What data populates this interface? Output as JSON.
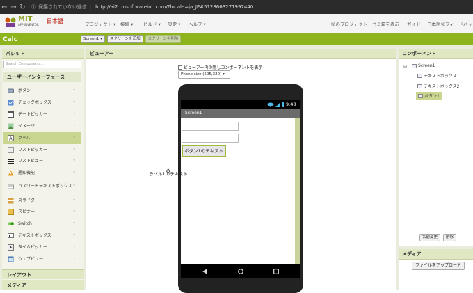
{
  "browser": {
    "security": "保護されていない通信",
    "url": "http://ai2.tmsoftwareinc.com/?locale=ja_JP#5128663271997440"
  },
  "header": {
    "logo_mit": "MIT",
    "logo_sub": "APP INVENTOR",
    "logo_lang": "日本語",
    "menus": [
      "プロジェクト ▾",
      "接続 ▾",
      "ビルド ▾",
      "設定 ▾",
      "ヘルプ ▾"
    ],
    "right_links": [
      "私のプロジェクト",
      "ゴミ箱を表示",
      "ガイド",
      "日本語化フィードバック"
    ]
  },
  "project": {
    "name": "Calc",
    "screen_select": "Screen1 ▾",
    "add_screen": "スクリーンを追加",
    "remove_screen": "スクリーンを削除"
  },
  "palette": {
    "title": "パレット",
    "search_placeholder": "Search Components...",
    "category": "ユーザーインターフェース",
    "items": [
      {
        "label": "ボタン",
        "icon": "button-icon"
      },
      {
        "label": "チェックボックス",
        "icon": "checkbox-icon"
      },
      {
        "label": "デートピッカー",
        "icon": "datepicker-icon"
      },
      {
        "label": "イメージ",
        "icon": "image-icon"
      },
      {
        "label": "ラベル",
        "icon": "label-icon",
        "selected": true
      },
      {
        "label": "リストピッカー",
        "icon": "listpicker-icon"
      },
      {
        "label": "リストビュー",
        "icon": "listview-icon"
      },
      {
        "label": "通知機能",
        "icon": "notifier-icon"
      },
      {
        "label": "パスワードテキストボックス",
        "icon": "password-icon"
      },
      {
        "label": "スライダー",
        "icon": "slider-icon"
      },
      {
        "label": "スピナー",
        "icon": "spinner-icon"
      },
      {
        "label": "Switch",
        "icon": "switch-icon"
      },
      {
        "label": "テキストボックス",
        "icon": "textbox-icon"
      },
      {
        "label": "タイムピッカー",
        "icon": "timepicker-icon"
      },
      {
        "label": "ウェブビュー",
        "icon": "webviewer-icon"
      }
    ],
    "help": "?",
    "layout_category": "レイアウト",
    "media_category": "メディア"
  },
  "viewer": {
    "title": "ビューアー",
    "hidden_checkbox_label": "ビューアー内の隠しコンポーネントを表示",
    "phone_size": "Phone size (505,320) ▾",
    "clock": "9:48",
    "screen_title": "Screen1",
    "button_text": "ボタン1のテキスト",
    "label_text": "ラベル1のテキスト"
  },
  "components": {
    "title": "コンポーネント",
    "tree": [
      "Screen1",
      "テキストボックス1",
      "テキストボックス2",
      "ボタン1"
    ],
    "rename": "名前変更",
    "delete": "削除"
  },
  "media": {
    "title": "メディア",
    "upload": "ファイルをアップロード"
  },
  "colors": {
    "accent": "#8db31d",
    "panel_header": "#dfe8c2",
    "selected": "#c9d68f"
  }
}
